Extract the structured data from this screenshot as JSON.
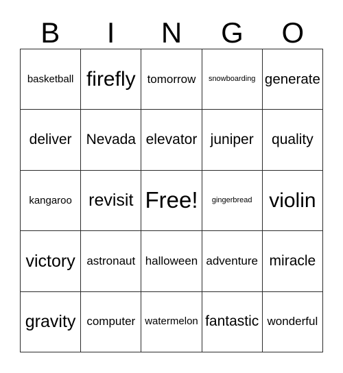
{
  "card": {
    "title": "BINGO",
    "free_space_label": "Free!",
    "border_color": "#2b2b2b",
    "text_color": "#000000",
    "background_color": "#ffffff"
  },
  "header": {
    "letters": [
      "B",
      "I",
      "N",
      "G",
      "O"
    ]
  },
  "grid": {
    "rows": 5,
    "columns": 5,
    "cells": [
      [
        {
          "label": "basketball",
          "size": "s"
        },
        {
          "label": "firefly",
          "size": "xxl"
        },
        {
          "label": "tomorrow",
          "size": "m"
        },
        {
          "label": "snowboarding",
          "size": "xs"
        },
        {
          "label": "generate",
          "size": "l"
        }
      ],
      [
        {
          "label": "deliver",
          "size": "l"
        },
        {
          "label": "Nevada",
          "size": "l"
        },
        {
          "label": "elevator",
          "size": "l"
        },
        {
          "label": "juniper",
          "size": "l"
        },
        {
          "label": "quality",
          "size": "l"
        }
      ],
      [
        {
          "label": "kangaroo",
          "size": "s"
        },
        {
          "label": "revisit",
          "size": "xl"
        },
        {
          "label": "Free!",
          "size": "free"
        },
        {
          "label": "gingerbread",
          "size": "xs"
        },
        {
          "label": "violin",
          "size": "xxl"
        }
      ],
      [
        {
          "label": "victory",
          "size": "xl"
        },
        {
          "label": "astronaut",
          "size": "m"
        },
        {
          "label": "halloween",
          "size": "m"
        },
        {
          "label": "adventure",
          "size": "m"
        },
        {
          "label": "miracle",
          "size": "l"
        }
      ],
      [
        {
          "label": "gravity",
          "size": "xl"
        },
        {
          "label": "computer",
          "size": "m"
        },
        {
          "label": "watermelon",
          "size": "s"
        },
        {
          "label": "fantastic",
          "size": "l"
        },
        {
          "label": "wonderful",
          "size": "m"
        }
      ]
    ]
  }
}
